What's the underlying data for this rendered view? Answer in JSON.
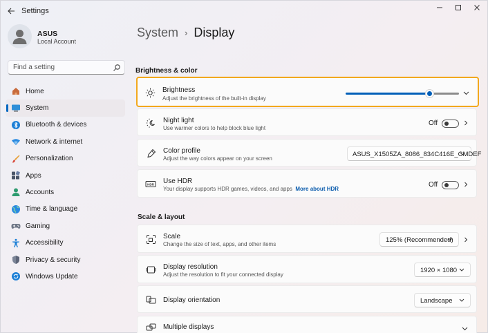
{
  "window": {
    "title": "Settings"
  },
  "user": {
    "name": "ASUS",
    "account_type": "Local Account"
  },
  "search": {
    "placeholder": "Find a setting"
  },
  "nav": {
    "items": [
      {
        "label": "Home",
        "icon": "home-icon"
      },
      {
        "label": "System",
        "icon": "system-icon",
        "selected": true
      },
      {
        "label": "Bluetooth & devices",
        "icon": "bluetooth-icon"
      },
      {
        "label": "Network & internet",
        "icon": "wifi-icon"
      },
      {
        "label": "Personalization",
        "icon": "brush-icon"
      },
      {
        "label": "Apps",
        "icon": "apps-icon"
      },
      {
        "label": "Accounts",
        "icon": "accounts-icon"
      },
      {
        "label": "Time & language",
        "icon": "globe-icon"
      },
      {
        "label": "Gaming",
        "icon": "gamepad-icon"
      },
      {
        "label": "Accessibility",
        "icon": "accessibility-icon"
      },
      {
        "label": "Privacy & security",
        "icon": "shield-icon"
      },
      {
        "label": "Windows Update",
        "icon": "update-icon"
      }
    ]
  },
  "header": {
    "parent": "System",
    "separator": "›",
    "current": "Display"
  },
  "sections": {
    "brightness_color": "Brightness & color",
    "scale_layout": "Scale & layout"
  },
  "settings": {
    "brightness": {
      "title": "Brightness",
      "subtitle": "Adjust the brightness of the built-in display",
      "level": 0.74
    },
    "night_light": {
      "title": "Night light",
      "subtitle": "Use warmer colors to help block blue light",
      "state": "Off"
    },
    "color_profile": {
      "title": "Color profile",
      "subtitle": "Adjust the way colors appear on your screen",
      "value": "ASUS_X1505ZA_8086_834C416E_CMDEF"
    },
    "hdr": {
      "title": "Use HDR",
      "subtitle": "Your display supports HDR games, videos, and apps",
      "link": "More about HDR",
      "state": "Off"
    },
    "scale": {
      "title": "Scale",
      "subtitle": "Change the size of text, apps, and other items",
      "value": "125% (Recommended)"
    },
    "resolution": {
      "title": "Display resolution",
      "subtitle": "Adjust the resolution to fit your connected display",
      "value": "1920 × 1080"
    },
    "orientation": {
      "title": "Display orientation",
      "value": "Landscape"
    },
    "multiple": {
      "title": "Multiple displays"
    }
  },
  "colors": {
    "accent": "#005fb8",
    "highlight": "#f2a81d"
  }
}
